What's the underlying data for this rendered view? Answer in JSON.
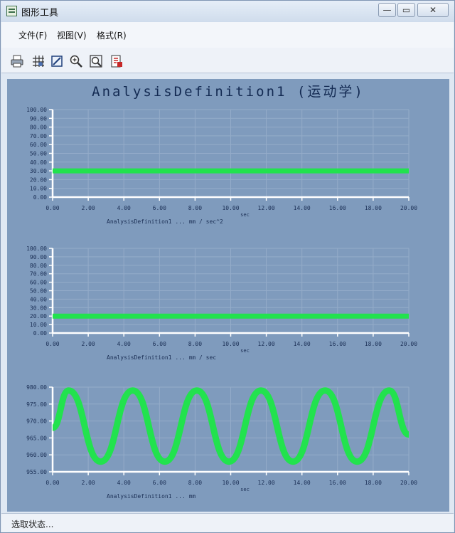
{
  "window": {
    "title": "图形工具",
    "min_label": "—",
    "max_label": "▭",
    "close_label": "✕"
  },
  "menu": [
    "文件(F)",
    "视图(V)",
    "格式(R)"
  ],
  "toolbar": {
    "icons": [
      "print-icon",
      "grid-icon",
      "format-icon",
      "zoom-in-icon",
      "zoom-fit-icon",
      "export-icon"
    ]
  },
  "plot": {
    "title": "AnalysisDefinition1 (运动学)"
  },
  "status": {
    "text": "选取状态..."
  },
  "colors": {
    "plot_bg": "#7f9bbd",
    "trace": "#22e24e",
    "grid": "#94acc9",
    "axis": "#ffffff"
  },
  "chart_data": [
    {
      "type": "line",
      "xlabel": "AnalysisDefinition1 ... mm / sec^2",
      "ylabel": "",
      "x_axis_unit": "sec",
      "xlim": [
        0,
        20
      ],
      "ylim": [
        0,
        100
      ],
      "x_ticks": [
        "0.00",
        "2.00",
        "4.00",
        "6.00",
        "8.00",
        "10.00",
        "12.00",
        "14.00",
        "16.00",
        "18.00",
        "20.00"
      ],
      "y_ticks": [
        "0.00",
        "10.00",
        "20.00",
        "30.00",
        "40.00",
        "50.00",
        "60.00",
        "70.00",
        "80.00",
        "90.00",
        "100.00"
      ],
      "series": [
        {
          "x": [
            0,
            20
          ],
          "values": [
            30,
            30
          ]
        }
      ]
    },
    {
      "type": "line",
      "xlabel": "AnalysisDefinition1 ... mm / sec",
      "ylabel": "",
      "x_axis_unit": "sec",
      "xlim": [
        0,
        20
      ],
      "ylim": [
        0,
        100
      ],
      "x_ticks": [
        "0.00",
        "2.00",
        "4.00",
        "6.00",
        "8.00",
        "10.00",
        "12.00",
        "14.00",
        "16.00",
        "18.00",
        "20.00"
      ],
      "y_ticks": [
        "0.00",
        "10.00",
        "20.00",
        "30.00",
        "40.00",
        "50.00",
        "60.00",
        "70.00",
        "80.00",
        "90.00",
        "100.00"
      ],
      "series": [
        {
          "x": [
            0,
            20
          ],
          "values": [
            20,
            20
          ]
        }
      ]
    },
    {
      "type": "line",
      "xlabel": "AnalysisDefinition1 ... mm",
      "ylabel": "",
      "x_axis_unit": "sec",
      "xlim": [
        0,
        20
      ],
      "ylim": [
        955,
        980
      ],
      "x_ticks": [
        "0.00",
        "2.00",
        "4.00",
        "6.00",
        "8.00",
        "10.00",
        "12.00",
        "14.00",
        "16.00",
        "18.00",
        "20.00"
      ],
      "y_ticks": [
        "955.00",
        "960.00",
        "965.00",
        "970.00",
        "975.00",
        "980.00"
      ],
      "series": [
        {
          "x": [
            0,
            0.9,
            2.7,
            4.5,
            6.3,
            8.1,
            9.9,
            11.7,
            13.5,
            15.3,
            17.1,
            18.9,
            20
          ],
          "values": [
            968,
            979,
            958,
            979,
            958,
            979,
            958,
            979,
            958,
            979,
            958,
            979,
            966
          ]
        }
      ]
    }
  ]
}
